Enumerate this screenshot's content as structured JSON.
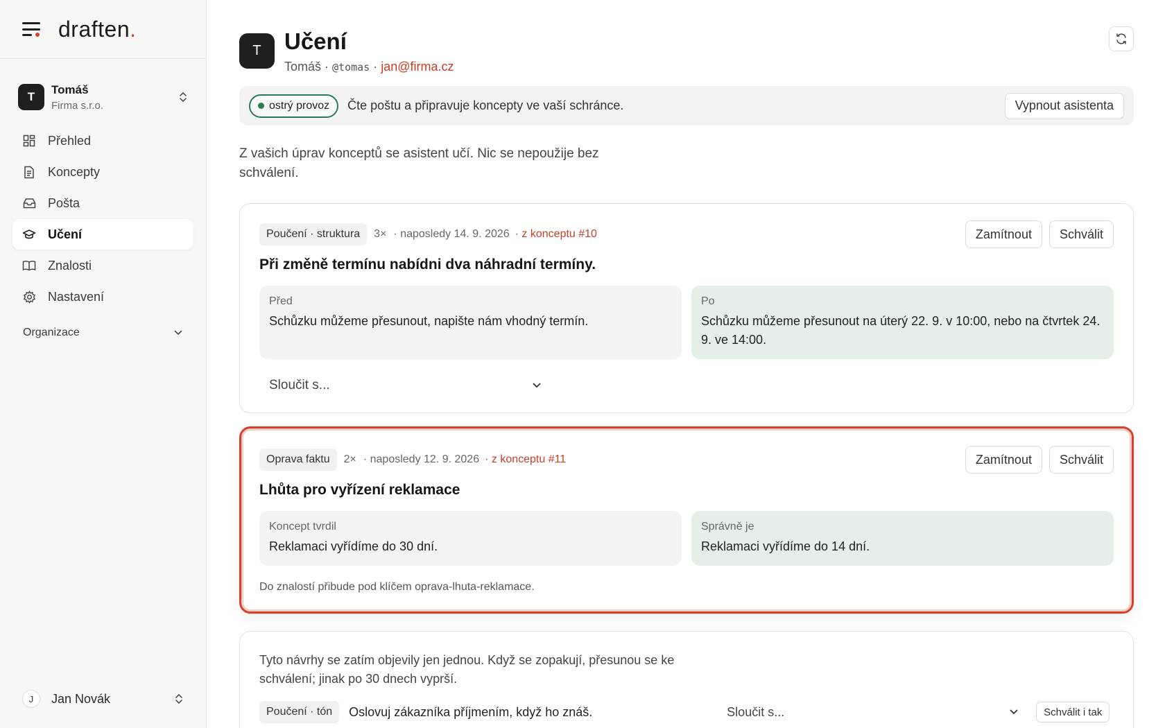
{
  "app": {
    "logo_text": "draften",
    "logo_dot": "."
  },
  "org": {
    "avatar": "T",
    "name": "Tomáš",
    "subtitle": "Firma s.r.o."
  },
  "nav": [
    {
      "label": "Přehled",
      "icon": "grid-icon"
    },
    {
      "label": "Koncepty",
      "icon": "document-icon"
    },
    {
      "label": "Pošta",
      "icon": "inbox-icon"
    },
    {
      "label": "Učení",
      "icon": "graduation-cap-icon",
      "active": true
    },
    {
      "label": "Znalosti",
      "icon": "book-icon"
    },
    {
      "label": "Nastavení",
      "icon": "gear-icon"
    }
  ],
  "nav_section": {
    "label": "Organizace"
  },
  "user": {
    "avatar": "J",
    "name": "Jan Novák"
  },
  "page": {
    "avatar": "T",
    "title": "Učení",
    "name": "Tomáš",
    "sep": "·",
    "handle": "@tomas",
    "email": "jan@firma.cz"
  },
  "status": {
    "pill": "ostrý provoz",
    "text": "Čte poštu a připravuje koncepty ve vaší schránce.",
    "button": "Vypnout asistenta"
  },
  "intro": "Z vašich úprav konceptů se asistent učí. Nic se nepoužije bez schválení.",
  "cards": [
    {
      "tag": "Poučení · struktura",
      "count": "3×",
      "last": "· naposledy 14. 9. 2026",
      "source": "· z konceptu #10",
      "reject": "Zamítnout",
      "approve": "Schválit",
      "title": "Při změně termínu nabídni dva náhradní termíny.",
      "before_label": "Před",
      "before_text": "Schůzku můžeme přesunout, napište nám vhodný termín.",
      "after_label": "Po",
      "after_text": "Schůzku můžeme přesunout na úterý 22. 9. v 10:00, nebo na čtvrtek 24. 9. ve 14:00.",
      "merge": "Sloučit s..."
    },
    {
      "tag": "Oprava faktu",
      "count": "2×",
      "last": "· naposledy 12. 9. 2026",
      "source": "· z konceptu #11",
      "reject": "Zamítnout",
      "approve": "Schválit",
      "title": "Lhůta pro vyřízení reklamace",
      "before_label": "Koncept tvrdil",
      "before_text": "Reklamaci vyřídíme do 30 dní.",
      "after_label": "Správně je",
      "after_text": "Reklamaci vyřídíme do 14 dní.",
      "note": "Do znalostí přibude pod klíčem oprava-lhuta-reklamace."
    }
  ],
  "pending": {
    "desc": "Tyto návrhy se zatím objevily jen jednou. Když se zopakují, přesunou se ke schválení; jinak po 30 dnech vyprší.",
    "tag": "Poučení · tón",
    "text": "Oslovuj zákazníka příjmením, když ho znáš.",
    "merge": "Sloučit s...",
    "approve_anyway": "Schválit i tak"
  },
  "colors": {
    "accent": "#d9402b",
    "live": "#2b7a53",
    "after_bg": "#e4efe8"
  }
}
